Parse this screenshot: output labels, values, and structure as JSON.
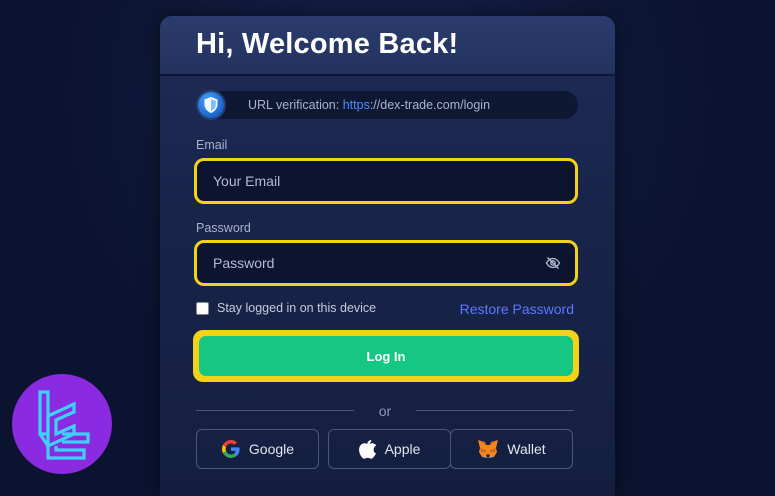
{
  "header": {
    "title": "Hi, Welcome Back!"
  },
  "url_verification": {
    "label": "URL verification: ",
    "protocol": "https",
    "rest": "://dex-trade.com/login"
  },
  "form": {
    "email_label": "Email",
    "email_placeholder": "Your Email",
    "password_label": "Password",
    "password_placeholder": "Password",
    "remember_label": "Stay logged in on this device",
    "restore_label": "Restore Password",
    "login_label": "Log In"
  },
  "divider": {
    "text": "or"
  },
  "social": [
    {
      "label": "Google",
      "icon": "google-icon"
    },
    {
      "label": "Apple",
      "icon": "apple-icon"
    },
    {
      "label": "Wallet",
      "icon": "metamask-fox-icon"
    }
  ],
  "colors": {
    "accent_green": "#16c784",
    "highlight_yellow": "#f3d21a",
    "link_blue": "#5d78ff",
    "badge_purple": "#8a2be2"
  }
}
